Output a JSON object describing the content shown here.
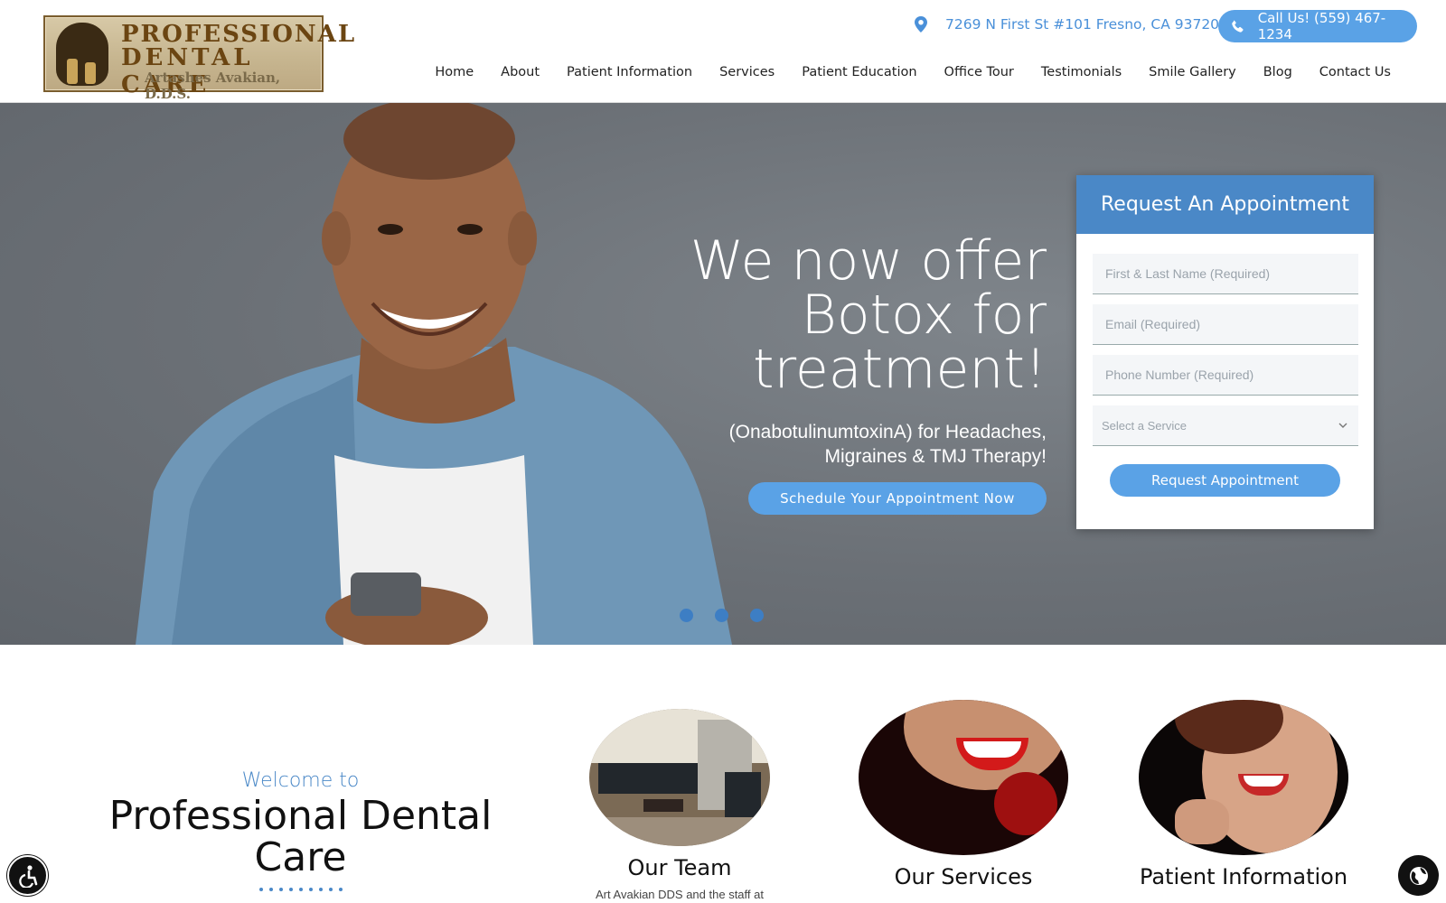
{
  "header": {
    "logo": {
      "line1": "PROFESSIONAL",
      "line2": "DENTAL CARE",
      "line3": "Artashes Avakian, D.D.S."
    },
    "address": "7269 N First St #101 Fresno, CA 93720",
    "address_icon": "map-pin-icon",
    "call_label": "Call Us! (559) 467-1234",
    "call_icon": "phone-icon"
  },
  "nav": [
    {
      "label": "Home"
    },
    {
      "label": "About"
    },
    {
      "label": "Patient Information"
    },
    {
      "label": "Services"
    },
    {
      "label": "Patient Education"
    },
    {
      "label": "Office Tour"
    },
    {
      "label": "Testimonials"
    },
    {
      "label": "Smile Gallery"
    },
    {
      "label": "Blog"
    },
    {
      "label": "Contact Us"
    }
  ],
  "hero": {
    "title": "We now offer Botox for treatment!",
    "subtitle": "(OnabotulinumtoxinA) for Headaches, Migraines & TMJ Therapy!",
    "cta": "Schedule Your Appointment Now",
    "slides": 3
  },
  "form": {
    "title": "Request An Appointment",
    "name_placeholder": "First & Last Name (Required)",
    "email_placeholder": "Email (Required)",
    "phone_placeholder": "Phone Number (Required)",
    "service_value": "Select a Service",
    "submit": "Request Appointment"
  },
  "welcome": {
    "pre": "Welcome to",
    "title": "Professional Dental Care"
  },
  "cards": [
    {
      "title": "Our Team",
      "text": "Art Avakian DDS and the staff at"
    },
    {
      "title": "Our Services",
      "text": ""
    },
    {
      "title": "Patient Information",
      "text": ""
    }
  ],
  "colors": {
    "accent": "#5aa2e6",
    "form_header": "#4a88c7",
    "hero_bg": "#6b7076"
  },
  "icons": {
    "accessibility": "accessibility-icon",
    "language": "globe-icon"
  }
}
